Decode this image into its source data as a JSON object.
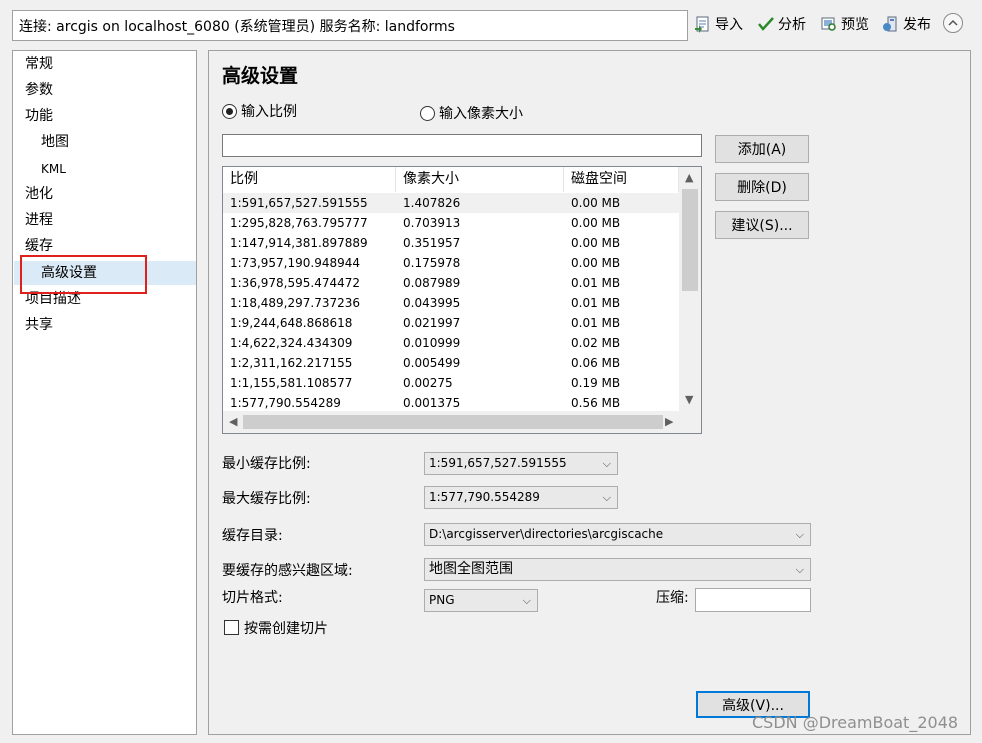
{
  "connection": {
    "label": "连接: arcgis on localhost_6080 (系统管理员)   服务名称: landforms"
  },
  "toolbar": {
    "import_label": "导入",
    "analyze_label": "分析",
    "preview_label": "预览",
    "publish_label": "发布"
  },
  "nav": {
    "items": [
      {
        "label": "常规"
      },
      {
        "label": "参数"
      },
      {
        "label": "功能"
      },
      {
        "label": "地图"
      },
      {
        "label": "KML"
      },
      {
        "label": "池化"
      },
      {
        "label": "进程"
      },
      {
        "label": "缓存"
      },
      {
        "label": "高级设置"
      },
      {
        "label": "项目描述"
      },
      {
        "label": "共享"
      }
    ]
  },
  "main": {
    "title": "高级设置",
    "radio_scale": "输入比例",
    "radio_pixel": "输入像素大小",
    "add_button": "添加(A)",
    "delete_button": "删除(D)",
    "suggest_button": "建议(S)...",
    "advanced_button": "高级(V)..."
  },
  "table": {
    "headers": [
      "比例",
      "像素大小",
      "磁盘空间"
    ],
    "rows": [
      [
        "1:591,657,527.591555",
        "1.407826",
        "0.00 MB"
      ],
      [
        "1:295,828,763.795777",
        "0.703913",
        "0.00 MB"
      ],
      [
        "1:147,914,381.897889",
        "0.351957",
        "0.00 MB"
      ],
      [
        "1:73,957,190.948944",
        "0.175978",
        "0.00 MB"
      ],
      [
        "1:36,978,595.474472",
        "0.087989",
        "0.01 MB"
      ],
      [
        "1:18,489,297.737236",
        "0.043995",
        "0.01 MB"
      ],
      [
        "1:9,244,648.868618",
        "0.021997",
        "0.01 MB"
      ],
      [
        "1:4,622,324.434309",
        "0.010999",
        "0.02 MB"
      ],
      [
        "1:2,311,162.217155",
        "0.005499",
        "0.06 MB"
      ],
      [
        "1:1,155,581.108577",
        "0.00275",
        "0.19 MB"
      ],
      [
        "1:577,790.554289",
        "0.001375",
        "0.56 MB"
      ]
    ]
  },
  "fields": {
    "min_scale_label": "最小缓存比例:",
    "min_scale_value": "1:591,657,527.591555",
    "max_scale_label": "最大缓存比例:",
    "max_scale_value": "1:577,790.554289",
    "cache_dir_label": "缓存目录:",
    "cache_dir_value": "D:\\arcgisserver\\directories\\arcgiscache",
    "aoi_label": "要缓存的感兴趣区域:",
    "aoi_value": "地图全图范围",
    "tile_format_label": "切片格式:",
    "tile_format_value": "PNG",
    "compress_label": "压缩:",
    "compress_value": "",
    "ondemand_label": "按需创建切片"
  },
  "watermark": "CSDN @DreamBoat_2048",
  "colors": {
    "selection": "#dbeaf7",
    "highlight_box": "#e0201b",
    "button_face": "#e1e1e1"
  }
}
